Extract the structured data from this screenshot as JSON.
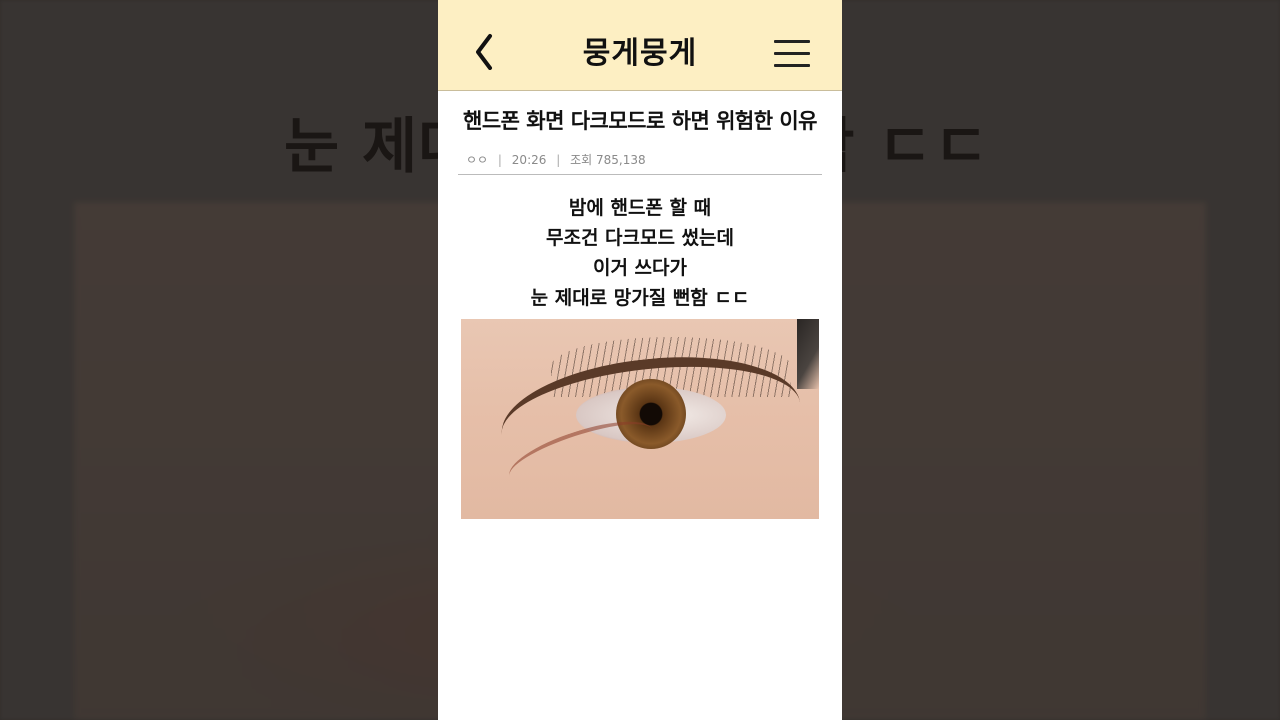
{
  "backdrop": {
    "title": "눈 제대로 망가질 뻔함 ㄷㄷ"
  },
  "header": {
    "app_title": "뭉게뭉게",
    "back_icon": "chevron-left-icon",
    "menu_icon": "hamburger-menu-icon",
    "background_color": "#fdefc3"
  },
  "post": {
    "title": "핸드폰 화면 다크모드로 하면 위험한 이유",
    "meta": {
      "author": "ㅇㅇ",
      "time": "20:26",
      "views": "조회 785,138"
    },
    "body_lines": [
      "밤에 핸드폰 할 때",
      "무조건 다크모드 썼는데",
      "이거 쓰다가",
      "눈 제대로 망가질 뻔함 ㄷㄷ"
    ],
    "image": "eye-closeup-photo"
  }
}
